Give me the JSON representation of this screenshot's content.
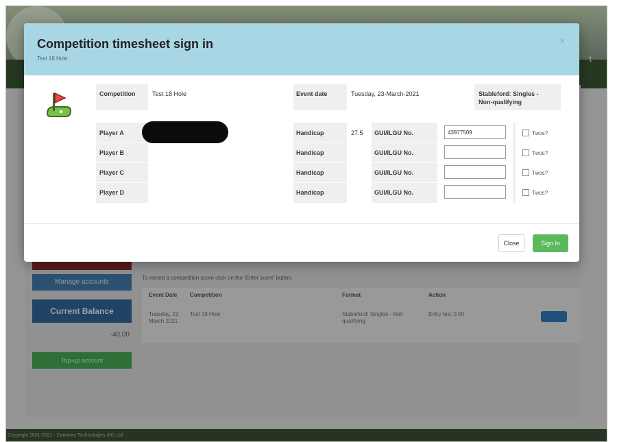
{
  "background": {
    "nav_fragment": "t",
    "manage_accounts_label": "Manage accounts",
    "current_balance_label": "Current Balance",
    "balance_amount": "-40.00",
    "topup_label": "Top-up account",
    "instruction": "To record a competition score click on the 'Enter score' button.",
    "table": {
      "headers": [
        "Event Date",
        "Competition",
        "Format",
        "Action"
      ],
      "row": {
        "event_date": "Tuesday, 23 March 2021",
        "competition": "Test 18 Hole",
        "format": "Stableford: Singles - Non qualifying",
        "action": "Entry fee: 0.00"
      }
    },
    "footer": "Copyright 2001-2021 - Cameras Technologies (NI) Ltd"
  },
  "modal": {
    "title": "Competition timesheet sign in",
    "subtitle": "Test 18 Hole",
    "close_icon": "close-icon",
    "flag_icon": "golf-flag-icon",
    "competition_label": "Competition",
    "competition_value": "Test 18 Hole",
    "event_date_label": "Event date",
    "event_date_value": "Tuesday, 23-March-2021",
    "format_line1": "Stableford: Singles -",
    "format_line2": "Non-qualifying",
    "players": [
      {
        "label": "Player A",
        "handicap_label": "Handicap",
        "handicap": "27.5",
        "gui_label": "GUI/ILGU No.",
        "gui_value": "43977509",
        "twos": "Twos?"
      },
      {
        "label": "Player B",
        "handicap_label": "Handicap",
        "handicap": "",
        "gui_label": "GUI/ILGU No.",
        "gui_value": "",
        "twos": "Twos?"
      },
      {
        "label": "Player C",
        "handicap_label": "Handicap",
        "handicap": "",
        "gui_label": "GUI/ILGU No.",
        "gui_value": "",
        "twos": "Twos?"
      },
      {
        "label": "Player D",
        "handicap_label": "Handicap",
        "handicap": "",
        "gui_label": "GUI/ILGU No.",
        "gui_value": "",
        "twos": "Twos?"
      }
    ],
    "close_button": "Close",
    "signin_button": "Sign In"
  },
  "colors": {
    "modal_header": "#a9d6e4",
    "signin_green": "#5cb85c",
    "balance_blue": "#2e5d8c"
  }
}
